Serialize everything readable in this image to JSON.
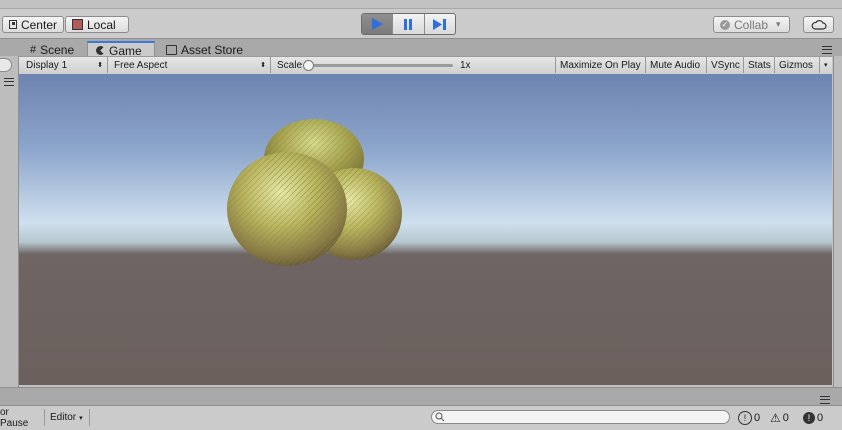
{
  "toolbar": {
    "pivot_label": "Center",
    "space_label": "Local",
    "collab_label": "Collab",
    "collab_arrow": "▾",
    "icons": [
      "pivot-icon",
      "local-icon",
      "play-icon",
      "pause-icon",
      "step-icon",
      "collab-check-icon",
      "cloud-icon"
    ]
  },
  "tabs": [
    {
      "label": "Scene",
      "icon": "grid-icon"
    },
    {
      "label": "Game",
      "icon": "pacman-icon",
      "active": true
    },
    {
      "label": "Asset Store",
      "icon": "bag-icon"
    }
  ],
  "game_bar": {
    "display": "Display 1",
    "aspect": "Free Aspect",
    "scale_label": "Scale",
    "scale_value": "1x",
    "maximize": "Maximize On Play",
    "mute": "Mute Audio",
    "vsync": "VSync",
    "stats": "Stats",
    "gizmos": "Gizmos"
  },
  "status": {
    "pause_label": "or Pause",
    "editor_label": "Editor",
    "info_count": "0",
    "warning_count": "0",
    "error_count": "0"
  },
  "colors": {
    "accent": "#3a79d8",
    "play_blue": "#2f6fdc",
    "sky_top": "#6d83b0",
    "horizon": "#cfe0ee",
    "ground": "#6b605c"
  }
}
